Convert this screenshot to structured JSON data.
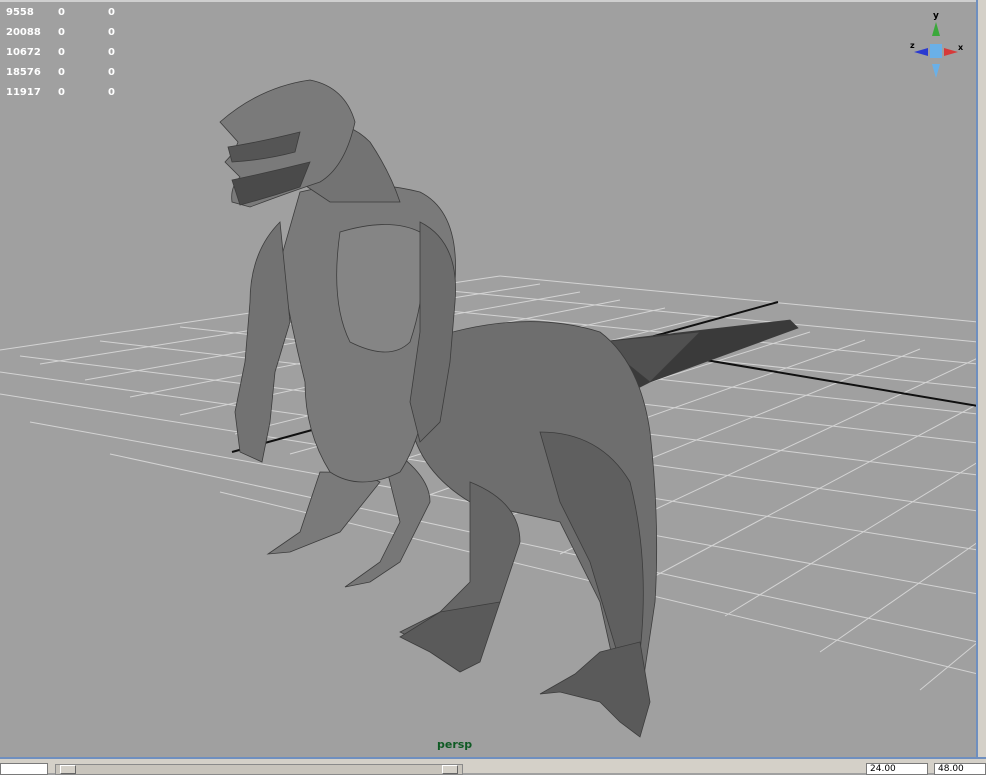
{
  "viewport": {
    "camera_label": "persp",
    "background_color": "#a0a0a0"
  },
  "heads_up_display": {
    "rows": [
      [
        "9558",
        "0",
        "0"
      ],
      [
        "20088",
        "0",
        "0"
      ],
      [
        "10672",
        "0",
        "0"
      ],
      [
        "18576",
        "0",
        "0"
      ],
      [
        "11917",
        "0",
        "0"
      ]
    ]
  },
  "axis_gizmo": {
    "y_label": "y",
    "x_label": "x",
    "z_label": "z",
    "colors": {
      "x": "#d63a3a",
      "y": "#3aa83a",
      "z": "#2a3ad0",
      "center": "#6ab0e8"
    }
  },
  "timeline": {
    "start_value": "",
    "range_start_value": "24.00",
    "range_end_value": "48.00"
  }
}
